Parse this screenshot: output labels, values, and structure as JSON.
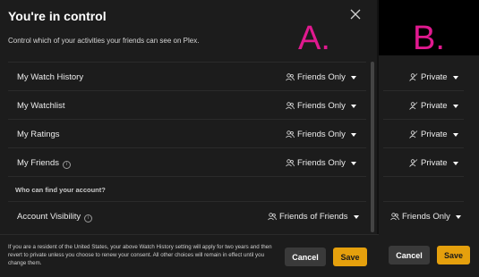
{
  "dialog": {
    "title": "You're in control",
    "subtitle": "Control which of your activities your friends can see on Plex."
  },
  "annotations": {
    "a": "A.",
    "b": "B."
  },
  "rows": [
    {
      "label": "My Watch History",
      "info": false,
      "a_value": "Friends Only",
      "a_icon": "friends-icon",
      "b_value": "Private",
      "b_icon": "private-icon"
    },
    {
      "label": "My Watchlist",
      "info": false,
      "a_value": "Friends Only",
      "a_icon": "friends-icon",
      "b_value": "Private",
      "b_icon": "private-icon"
    },
    {
      "label": "My Ratings",
      "info": false,
      "a_value": "Friends Only",
      "a_icon": "friends-icon",
      "b_value": "Private",
      "b_icon": "private-icon"
    },
    {
      "label": "My Friends",
      "info": true,
      "a_value": "Friends Only",
      "a_icon": "friends-icon",
      "b_value": "Private",
      "b_icon": "private-icon"
    }
  ],
  "section": {
    "heading": "Who can find your account?"
  },
  "visibility": {
    "label": "Account Visibility",
    "a_value": "Friends of Friends",
    "b_value": "Friends Only"
  },
  "footer": {
    "notice": "If you are a resident of the United States, your above Watch History setting will apply for two years and then revert to private unless you choose to renew your consent. All other choices will remain in effect until you change them.",
    "cancel_label": "Cancel",
    "save_label": "Save"
  },
  "colors": {
    "accent": "#e5a00d",
    "annotation": "#e0198f",
    "background": "#1c1c1c"
  }
}
